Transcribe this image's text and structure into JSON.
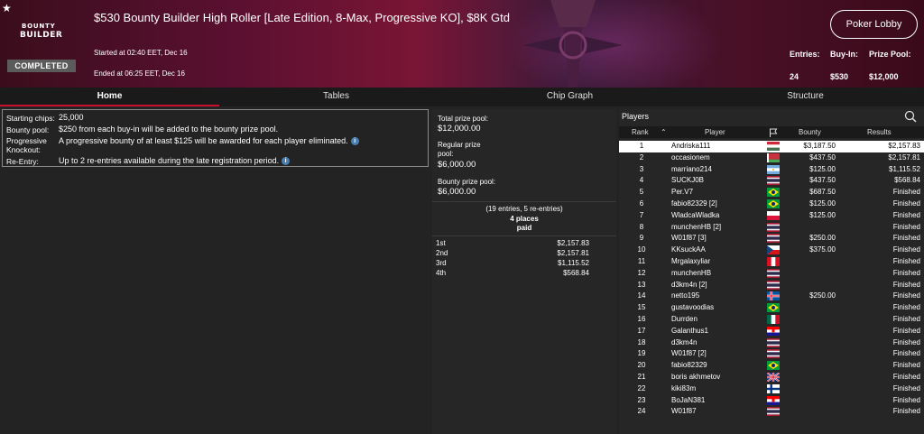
{
  "header": {
    "logo_line1": "BOUNTY",
    "logo_line2": "BUILDER",
    "status": "COMPLETED",
    "title": "$530 Bounty Builder High Roller [Late Edition, 8-Max, Progressive KO], $8K Gtd",
    "started": "Started at 02:40 EET, Dec 16",
    "ended": "Ended at 06:25 EET, Dec 16",
    "lobby_button": "Poker Lobby",
    "entries_label": "Entries:",
    "entries_value": "24",
    "buyin_label": "Buy-In:",
    "buyin_value": "$530",
    "prizepool_label": "Prize Pool:",
    "prizepool_value": "$12,000"
  },
  "tabs": [
    "Home",
    "Tables",
    "Chip Graph",
    "Structure"
  ],
  "info": {
    "starting_chips_label": "Starting chips:",
    "starting_chips_value": "25,000",
    "bounty_pool_label": "Bounty pool:",
    "bounty_pool_value": "$250 from each buy-in will be added to the bounty prize pool.",
    "progressive_label_1": "Progressive",
    "progressive_label_2": "Knockout:",
    "progressive_value": "A progressive bounty of at least $125 will be awarded for each player eliminated.",
    "reentry_label": "Re-Entry:",
    "reentry_value": "Up to 2 re-entries available during the late registration period."
  },
  "pool": {
    "total_label": "Total prize pool:",
    "total_value": "$12,000.00",
    "regular_label_1": "Regular prize",
    "regular_label_2": "pool:",
    "regular_value": "$6,000.00",
    "bounty_label": "Bounty prize pool:",
    "bounty_value": "$6,000.00",
    "entries_note": "(19 entries, 5 re-entries)",
    "places_line1": "4 places",
    "places_line2": "paid",
    "payouts": [
      {
        "place": "1st",
        "amount": "$2,157.83"
      },
      {
        "place": "2nd",
        "amount": "$2,157.81"
      },
      {
        "place": "3rd",
        "amount": "$1,115.52"
      },
      {
        "place": "4th",
        "amount": "$568.84"
      }
    ]
  },
  "players": {
    "title": "Players",
    "col_rank": "Rank",
    "col_player": "Player",
    "col_bounty": "Bounty",
    "col_results": "Results",
    "rows": [
      {
        "rank": "1",
        "name": "Andriska111",
        "flag": "hungary",
        "bounty": "$3,187.50",
        "result": "$2,157.83"
      },
      {
        "rank": "2",
        "name": "occasionem",
        "flag": "belarus",
        "bounty": "$437.50",
        "result": "$2,157.81"
      },
      {
        "rank": "3",
        "name": "marriano214",
        "flag": "argentina",
        "bounty": "$125.00",
        "result": "$1,115.52"
      },
      {
        "rank": "4",
        "name": "SUCKJ0B",
        "flag": "thailand",
        "bounty": "$437.50",
        "result": "$568.84"
      },
      {
        "rank": "5",
        "name": "Per.V7",
        "flag": "brazil",
        "bounty": "$687.50",
        "result": "Finished"
      },
      {
        "rank": "6",
        "name": "fabio82329 [2]",
        "flag": "brazil",
        "bounty": "$125.00",
        "result": "Finished"
      },
      {
        "rank": "7",
        "name": "WladcaWladka",
        "flag": "poland",
        "bounty": "$125.00",
        "result": "Finished"
      },
      {
        "rank": "8",
        "name": "munchenHB [2]",
        "flag": "thailand",
        "bounty": "",
        "result": "Finished"
      },
      {
        "rank": "9",
        "name": "W01f87 [3]",
        "flag": "thailand",
        "bounty": "$250.00",
        "result": "Finished"
      },
      {
        "rank": "10",
        "name": "KKsuckAA",
        "flag": "czech",
        "bounty": "$375.00",
        "result": "Finished"
      },
      {
        "rank": "11",
        "name": "Mrgalaxyliar",
        "flag": "peru",
        "bounty": "",
        "result": "Finished"
      },
      {
        "rank": "12",
        "name": "munchenHB",
        "flag": "thailand",
        "bounty": "",
        "result": "Finished"
      },
      {
        "rank": "13",
        "name": "d3km4n [2]",
        "flag": "thailand",
        "bounty": "",
        "result": "Finished"
      },
      {
        "rank": "14",
        "name": "netto195",
        "flag": "iceland",
        "bounty": "$250.00",
        "result": "Finished"
      },
      {
        "rank": "15",
        "name": "gustavoodias",
        "flag": "brazil",
        "bounty": "",
        "result": "Finished"
      },
      {
        "rank": "16",
        "name": "Durrden",
        "flag": "mexico",
        "bounty": "",
        "result": "Finished"
      },
      {
        "rank": "17",
        "name": "Galanthus1",
        "flag": "croatia",
        "bounty": "",
        "result": "Finished"
      },
      {
        "rank": "18",
        "name": "d3km4n",
        "flag": "thailand",
        "bounty": "",
        "result": "Finished"
      },
      {
        "rank": "19",
        "name": "W01f87 [2]",
        "flag": "thailand",
        "bounty": "",
        "result": "Finished"
      },
      {
        "rank": "20",
        "name": "fabio82329",
        "flag": "brazil",
        "bounty": "",
        "result": "Finished"
      },
      {
        "rank": "21",
        "name": "boris akhmetov",
        "flag": "uk",
        "bounty": "",
        "result": "Finished"
      },
      {
        "rank": "22",
        "name": "kiki83m",
        "flag": "finland",
        "bounty": "",
        "result": "Finished"
      },
      {
        "rank": "23",
        "name": "BoJaN381",
        "flag": "croatia",
        "bounty": "",
        "result": "Finished"
      },
      {
        "rank": "24",
        "name": "W01f87",
        "flag": "thailand",
        "bounty": "",
        "result": "Finished"
      }
    ]
  },
  "colors": {
    "accent": "#c8102e",
    "panel": "#262626",
    "background": "#232323"
  }
}
